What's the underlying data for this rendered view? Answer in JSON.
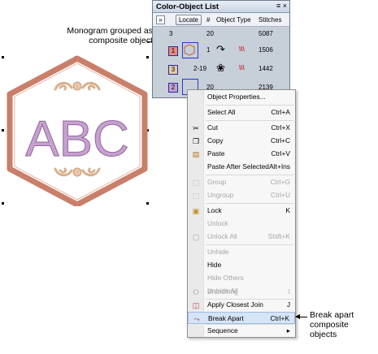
{
  "annotations": {
    "monogram_line1": "Monogram grouped as",
    "monogram_line2": "composite object",
    "break_line1": "Break apart",
    "break_line2": "composite",
    "break_line3": "objects"
  },
  "design": {
    "letters": "ABC",
    "colors": {
      "outline": "#c97f6a",
      "letters": "#c79fd0",
      "ornament": "#e0c0a5"
    }
  },
  "panel": {
    "title": "Color-Object List",
    "title_controls": "≡ ×",
    "expand_glyph": "»",
    "headers": {
      "locate": "Locate",
      "hash": "#",
      "object_type": "Object Type",
      "stitches": "Stitches"
    },
    "rows": [
      {
        "num": "3",
        "count": "20",
        "stitches": "5087"
      },
      {
        "num": "1",
        "count": "1",
        "stitches": "1506"
      },
      {
        "num": "3",
        "count": "2-19",
        "stitches": "1442"
      },
      {
        "num": "2",
        "count": "20",
        "stitches": "2139"
      }
    ]
  },
  "menu": {
    "items": [
      {
        "label": "Object Properties...",
        "shortcut": "",
        "icon": "",
        "disabled": false
      },
      {
        "label": "Select All",
        "shortcut": "Ctrl+A",
        "icon": "",
        "disabled": false
      },
      {
        "label": "Cut",
        "shortcut": "Ctrl+X",
        "icon": "scissors-icon",
        "disabled": false
      },
      {
        "label": "Copy",
        "shortcut": "Ctrl+C",
        "icon": "copy-icon",
        "disabled": false
      },
      {
        "label": "Paste",
        "shortcut": "Ctrl+V",
        "icon": "paste-icon",
        "disabled": false
      },
      {
        "label": "Paste After Selected",
        "shortcut": "Alt+Ins",
        "icon": "",
        "disabled": false
      },
      {
        "label": "Group",
        "shortcut": "Ctrl+G",
        "icon": "group-icon",
        "disabled": true
      },
      {
        "label": "Ungroup",
        "shortcut": "Ctrl+U",
        "icon": "ungroup-icon",
        "disabled": true
      },
      {
        "label": "Lock",
        "shortcut": "K",
        "icon": "lock-icon",
        "disabled": false
      },
      {
        "label": "Unlock",
        "shortcut": "",
        "icon": "",
        "disabled": true
      },
      {
        "label": "Unlock All",
        "shortcut": "Shift+K",
        "icon": "unlock-icon",
        "disabled": true
      },
      {
        "label": "Unhide",
        "shortcut": "",
        "icon": "",
        "disabled": true
      },
      {
        "label": "Hide",
        "shortcut": "",
        "icon": "",
        "disabled": false
      },
      {
        "label": "Hide Others",
        "shortcut": "",
        "icon": "",
        "disabled": true
      },
      {
        "label": "Unhide All",
        "shortcut": "",
        "icon": "",
        "disabled": true
      },
      {
        "label": "Branching",
        "shortcut": "I",
        "icon": "branching-icon",
        "disabled": true
      },
      {
        "label": "Apply Closest Join",
        "shortcut": "J",
        "icon": "closest-join-icon",
        "disabled": false
      },
      {
        "label": "Break Apart",
        "shortcut": "Ctrl+K",
        "icon": "break-apart-icon",
        "disabled": false,
        "highlighted": true
      },
      {
        "label": "Sequence",
        "shortcut": "▸",
        "icon": "",
        "disabled": false
      }
    ]
  }
}
